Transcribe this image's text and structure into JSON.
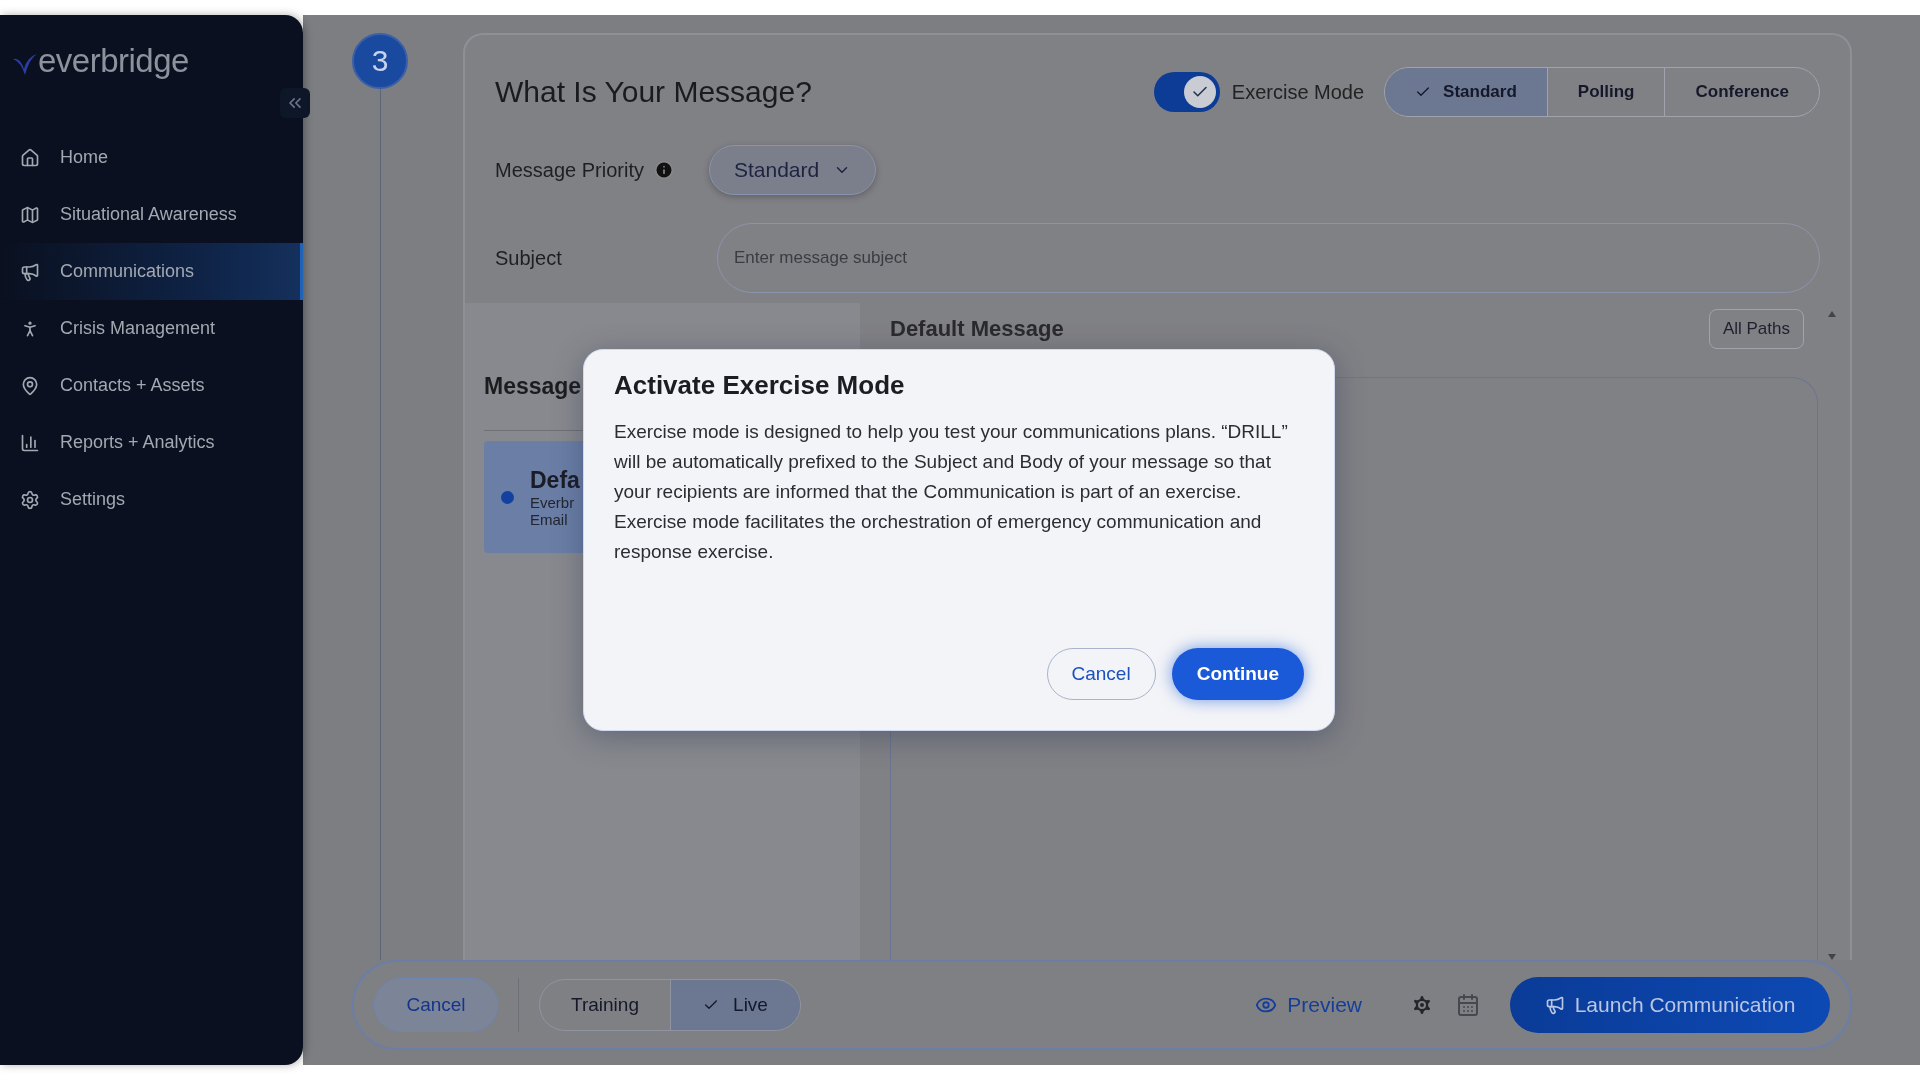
{
  "sidebar": {
    "logo": "everbridge",
    "items": [
      {
        "label": "Home",
        "selected": false
      },
      {
        "label": "Situational Awareness",
        "selected": false
      },
      {
        "label": "Communications",
        "selected": true
      },
      {
        "label": "Crisis Management",
        "selected": false
      },
      {
        "label": "Contacts + Assets",
        "selected": false
      },
      {
        "label": "Reports + Analytics",
        "selected": false
      },
      {
        "label": "Settings",
        "selected": false
      }
    ]
  },
  "step": {
    "number": "3"
  },
  "message": {
    "title": "What Is Your Message?",
    "exercise_mode": {
      "label": "Exercise Mode",
      "on": true
    },
    "types": [
      {
        "label": "Standard",
        "selected": true
      },
      {
        "label": "Polling",
        "selected": false
      },
      {
        "label": "Conference",
        "selected": false
      }
    ],
    "priority": {
      "label": "Message Priority",
      "value": "Standard"
    },
    "subject": {
      "label": "Subject",
      "placeholder": "Enter message subject"
    },
    "panel": {
      "heading": "Message",
      "cards": [
        {
          "title": "Defa",
          "lines": [
            "Everbr",
            "Email"
          ],
          "selected": true
        }
      ]
    },
    "content": {
      "heading": "Default Message",
      "paths_button": "All Paths"
    }
  },
  "footer": {
    "cancel": "Cancel",
    "modes": [
      {
        "label": "Training",
        "selected": false
      },
      {
        "label": "Live",
        "selected": true
      }
    ],
    "preview": "Preview",
    "launch": "Launch Communication"
  },
  "dialog": {
    "title": "Activate Exercise Mode",
    "body": "Exercise mode is designed to help you test your communications plans. “DRILL” will be automatically prefixed to the Subject and Body of your message so that your recipients are informed that the Communication is part of an exercise. Exercise mode facilitates the orchestration of emergency communication and response exercise.",
    "buttons": [
      {
        "label": "Cancel",
        "kind": "secondary"
      },
      {
        "label": "Continue",
        "kind": "primary"
      }
    ]
  }
}
